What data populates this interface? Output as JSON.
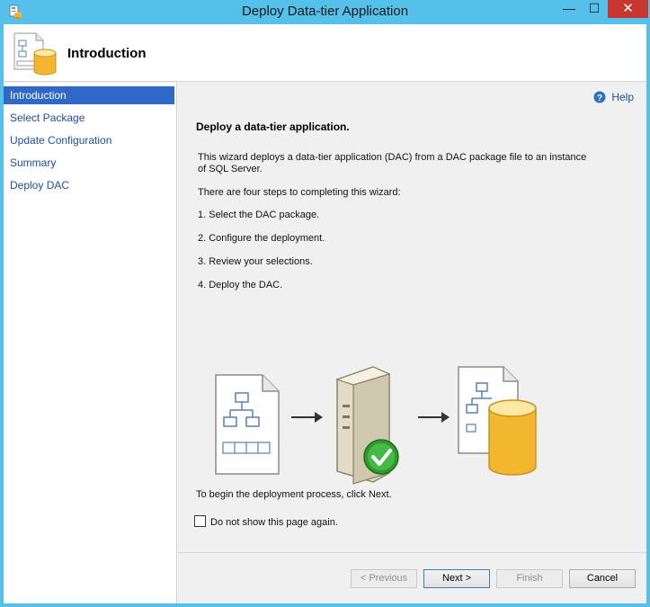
{
  "window": {
    "title": "Deploy Data-tier Application",
    "controls": {
      "minimize": "—",
      "maximize": "☐",
      "close": "✕"
    }
  },
  "header": {
    "title": "Introduction",
    "icon": "dac-database-icon"
  },
  "sidebar": {
    "items": [
      {
        "label": "Introduction",
        "active": true
      },
      {
        "label": "Select Package",
        "active": false
      },
      {
        "label": "Update Configuration",
        "active": false
      },
      {
        "label": "Summary",
        "active": false
      },
      {
        "label": "Deploy DAC",
        "active": false
      }
    ]
  },
  "main": {
    "help_label": "Help",
    "heading": "Deploy a data-tier application.",
    "intro": "This wizard deploys a data-tier application (DAC) from a DAC package file to an instance of SQL Server.",
    "steps_intro": "There are four steps to completing this wizard:",
    "steps": [
      "1. Select the DAC package.",
      "2. Configure the deployment.",
      "3. Review your selections.",
      "4. Deploy the DAC."
    ],
    "begin_text": "To begin the deployment process, click Next.",
    "checkbox_label": "Do not show this page again.",
    "checkbox_checked": false
  },
  "buttons": {
    "previous": "< Previous",
    "next": "Next >",
    "finish": "Finish",
    "cancel": "Cancel"
  },
  "colors": {
    "title_bar": "#55c0ea",
    "close_button": "#c7372f",
    "nav_active": "#3068c8",
    "link": "#1e4e9c"
  }
}
